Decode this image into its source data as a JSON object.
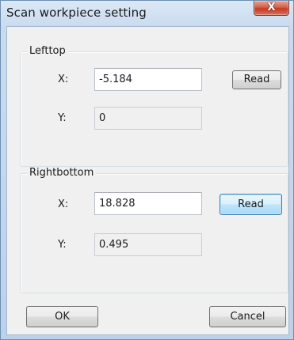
{
  "window": {
    "title": "Scan workpiece setting",
    "close_glyph": "X"
  },
  "lefttop": {
    "group_label": "Lefttop",
    "x_label": "X:",
    "x_value": "-5.184",
    "y_label": "Y:",
    "y_value": "0",
    "read_label": "Read"
  },
  "rightbottom": {
    "group_label": "Rightbottom",
    "x_label": "X:",
    "x_value": "18.828",
    "y_label": "Y:",
    "y_value": "0.495",
    "read_label": "Read"
  },
  "footer": {
    "ok_label": "OK",
    "cancel_label": "Cancel"
  }
}
